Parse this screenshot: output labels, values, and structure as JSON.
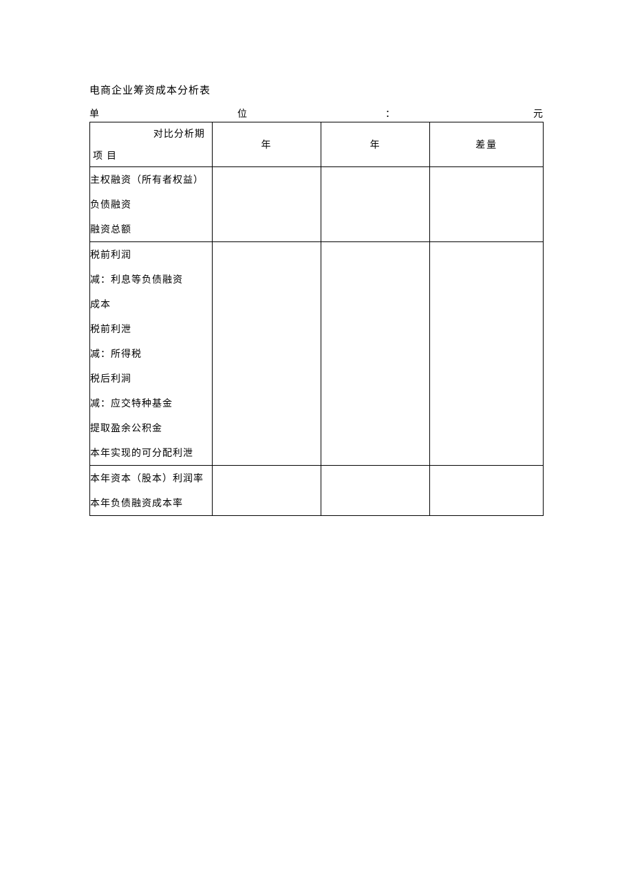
{
  "title": "电商企业筹资成本分析表",
  "unit_row": {
    "a": "单",
    "b": "位",
    "c": "：",
    "d": "元"
  },
  "header": {
    "diag_top": "对比分析期",
    "diag_bottom": "项目",
    "col1": "年",
    "col2": "年",
    "col3": "差量"
  },
  "block1": {
    "l1": "主权融资（所有者权益）",
    "l2": "负债融资",
    "l3": "融资总额"
  },
  "block2": {
    "l1": "税前利润",
    "l2": "减：利息等负债融资",
    "l3": "成本",
    "l4": "税前利泄",
    "l5": "减：所得税",
    "l6": "税后利涧",
    "l7": "减：应交特种基金",
    "l8": "提取盈余公积金",
    "l9": "本年实现的可分配利泄"
  },
  "block3": {
    "l1": "本年资本（股本）利润率",
    "l2": "本年负债融资成本率"
  }
}
